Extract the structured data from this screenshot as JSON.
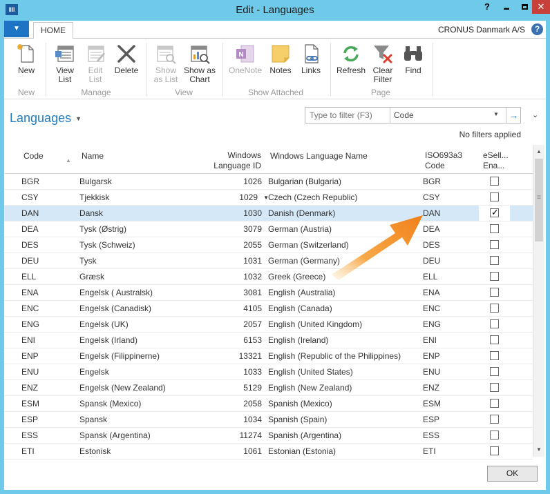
{
  "window": {
    "title": "Edit - Languages",
    "help_glyph": "?",
    "minimize_glyph": "▬",
    "close_glyph": "✕"
  },
  "ribbon": {
    "active_tab": "HOME",
    "company": "CRONUS Danmark A/S",
    "groups": {
      "new": "New",
      "manage": "Manage",
      "view": "View",
      "show_attached": "Show Attached",
      "page": "Page"
    },
    "buttons": {
      "new": "New",
      "view_list": [
        "View",
        "List"
      ],
      "edit_list": [
        "Edit",
        "List"
      ],
      "delete": "Delete",
      "show_as_list": [
        "Show",
        "as List"
      ],
      "show_as_chart": [
        "Show as",
        "Chart"
      ],
      "onenote": "OneNote",
      "notes": "Notes",
      "links": "Links",
      "refresh": "Refresh",
      "clear_filter": [
        "Clear",
        "Filter"
      ],
      "find": "Find"
    }
  },
  "page": {
    "title": "Languages",
    "filter_placeholder": "Type to filter (F3)",
    "filter_field": "Code",
    "no_filters": "No filters applied"
  },
  "columns": {
    "code": "Code",
    "name": "Name",
    "windows_language_id": [
      "Windows",
      "Language ID"
    ],
    "windows_language_name": "Windows Language Name",
    "iso": [
      "ISO693a3",
      "Code"
    ],
    "esell": [
      "eSell...",
      "Ena..."
    ]
  },
  "rows": [
    {
      "code": "BGR",
      "name": "Bulgarsk",
      "id": "1026",
      "wname": "Bulgarian (Bulgaria)",
      "iso": "BGR",
      "esell": false
    },
    {
      "code": "CSY",
      "name": "Tjekkisk",
      "id": "1029",
      "wname": "Czech (Czech Republic)",
      "iso": "CSY",
      "esell": false
    },
    {
      "code": "DAN",
      "name": "Dansk",
      "id": "1030",
      "wname": "Danish (Denmark)",
      "iso": "DAN",
      "esell": true
    },
    {
      "code": "DEA",
      "name": "Tysk (Østrig)",
      "id": "3079",
      "wname": "German (Austria)",
      "iso": "DEA",
      "esell": false
    },
    {
      "code": "DES",
      "name": "Tysk (Schweiz)",
      "id": "2055",
      "wname": "German (Switzerland)",
      "iso": "DES",
      "esell": false
    },
    {
      "code": "DEU",
      "name": "Tysk",
      "id": "1031",
      "wname": "German (Germany)",
      "iso": "DEU",
      "esell": false
    },
    {
      "code": "ELL",
      "name": "Græsk",
      "id": "1032",
      "wname": "Greek (Greece)",
      "iso": "ELL",
      "esell": false
    },
    {
      "code": "ENA",
      "name": "Engelsk ( Australsk)",
      "id": "3081",
      "wname": "English (Australia)",
      "iso": "ENA",
      "esell": false
    },
    {
      "code": "ENC",
      "name": "Engelsk (Canadisk)",
      "id": "4105",
      "wname": "English (Canada)",
      "iso": "ENC",
      "esell": false
    },
    {
      "code": "ENG",
      "name": "Engelsk (UK)",
      "id": "2057",
      "wname": "English (United Kingdom)",
      "iso": "ENG",
      "esell": false
    },
    {
      "code": "ENI",
      "name": "Engelsk (Irland)",
      "id": "6153",
      "wname": "English (Ireland)",
      "iso": "ENI",
      "esell": false
    },
    {
      "code": "ENP",
      "name": "Engelsk (Filippinerne)",
      "id": "13321",
      "wname": "English (Republic of the Philippines)",
      "iso": "ENP",
      "esell": false
    },
    {
      "code": "ENU",
      "name": "Engelsk",
      "id": "1033",
      "wname": "English (United States)",
      "iso": "ENU",
      "esell": false
    },
    {
      "code": "ENZ",
      "name": "Engelsk (New Zealand)",
      "id": "5129",
      "wname": "English (New Zealand)",
      "iso": "ENZ",
      "esell": false
    },
    {
      "code": "ESM",
      "name": "Spansk (Mexico)",
      "id": "2058",
      "wname": "Spanish (Mexico)",
      "iso": "ESM",
      "esell": false
    },
    {
      "code": "ESP",
      "name": "Spansk",
      "id": "1034",
      "wname": "Spanish (Spain)",
      "iso": "ESP",
      "esell": false
    },
    {
      "code": "ESS",
      "name": "Spansk (Argentina)",
      "id": "11274",
      "wname": "Spanish (Argentina)",
      "iso": "ESS",
      "esell": false
    },
    {
      "code": "ETI",
      "name": "Estonisk",
      "id": "1061",
      "wname": "Estonian (Estonia)",
      "iso": "ETI",
      "esell": false
    }
  ],
  "selected_row_index": 2,
  "dropdown_row_index": 1,
  "footer": {
    "ok": "OK"
  },
  "colors": {
    "titlebar": "#6ecae8",
    "accent": "#1e7cc4",
    "selected_row": "#d5e8f7",
    "arrow": "#f28a1e"
  }
}
